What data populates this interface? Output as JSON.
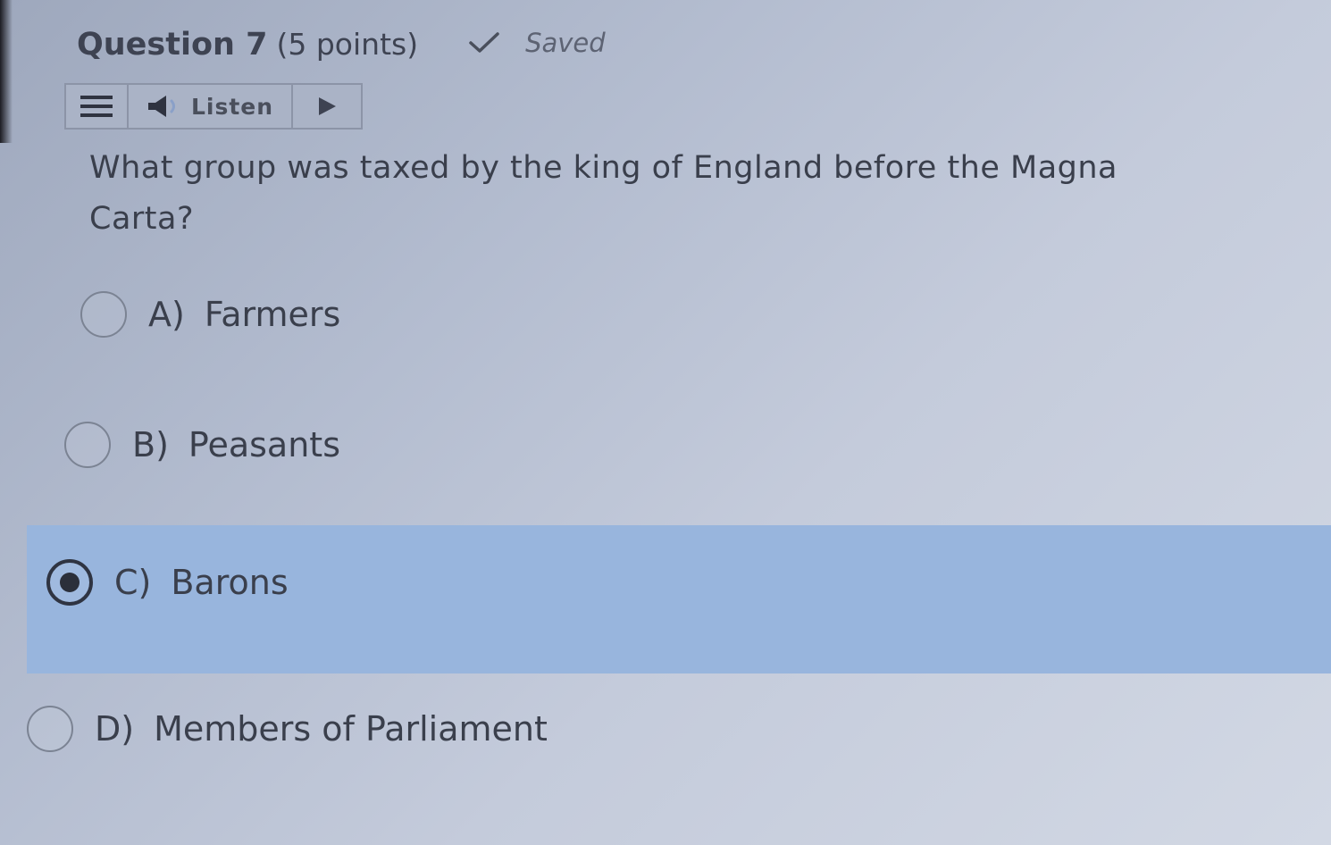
{
  "question": {
    "title": "Question 7",
    "points": "(5 points)",
    "save_status": "Saved",
    "text": "What group was taxed by the king of England before the Magna Carta?"
  },
  "toolbar": {
    "menu_icon": "menu-icon",
    "speaker_icon": "speaker-icon",
    "listen_label": "Listen",
    "play_icon": "play-icon"
  },
  "options": [
    {
      "letter": "A)",
      "text": "Farmers",
      "selected": false
    },
    {
      "letter": "B)",
      "text": "Peasants",
      "selected": false
    },
    {
      "letter": "C)",
      "text": "Barons",
      "selected": true
    },
    {
      "letter": "D)",
      "text": "Members of Parliament",
      "selected": false
    }
  ],
  "colors": {
    "selected_highlight": "#98b5dd",
    "text": "#3a3f4c"
  }
}
